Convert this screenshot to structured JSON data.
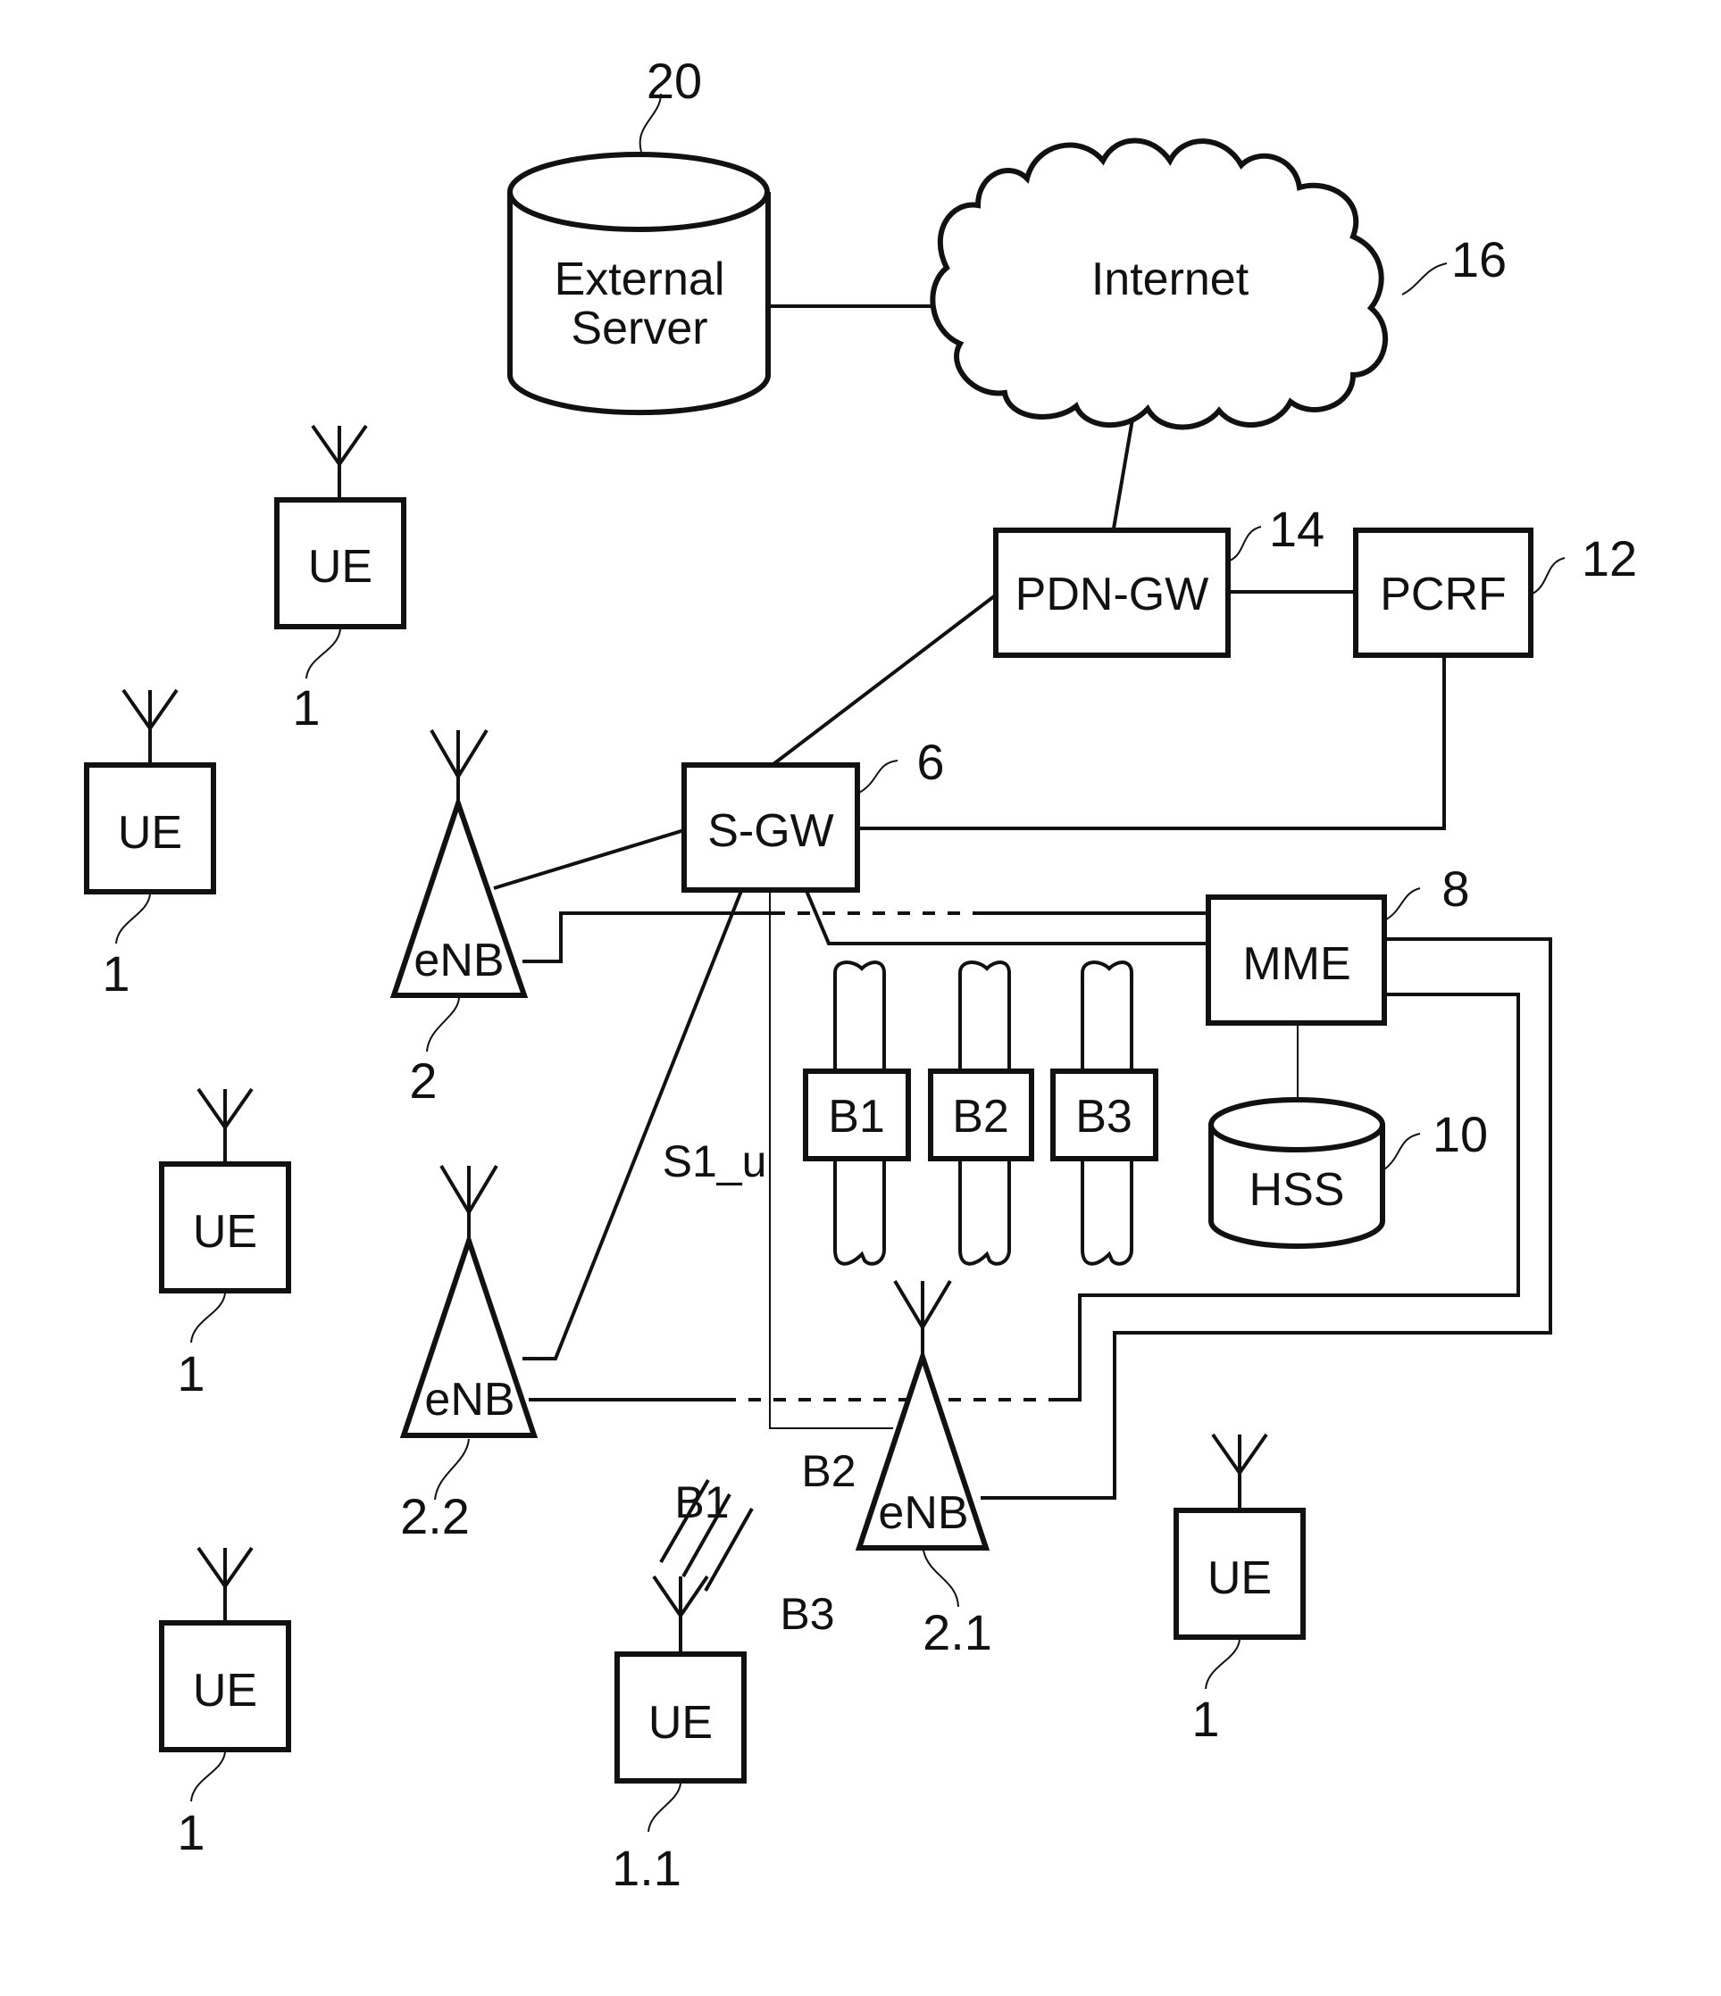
{
  "diagram": {
    "external_server": {
      "label_line1": "External",
      "label_line2": "Server",
      "ref": "20"
    },
    "internet": {
      "label": "Internet",
      "ref": "16"
    },
    "pdn_gw": {
      "label": "PDN-GW",
      "ref": "14"
    },
    "pcrf": {
      "label": "PCRF",
      "ref": "12"
    },
    "s_gw": {
      "label": "S-GW",
      "ref": "6"
    },
    "mme": {
      "label": "MME",
      "ref": "8"
    },
    "hss": {
      "label": "HSS",
      "ref": "10"
    },
    "bearers": [
      {
        "label": "B1"
      },
      {
        "label": "B2"
      },
      {
        "label": "B3"
      }
    ],
    "interface_label": "S1_u",
    "enbs": [
      {
        "label": "eNB",
        "ref": "2"
      },
      {
        "label": "eNB",
        "ref": "2.2"
      },
      {
        "label": "eNB",
        "ref": "2.1"
      }
    ],
    "ues": [
      {
        "label": "UE",
        "ref": "1"
      },
      {
        "label": "UE",
        "ref": "1"
      },
      {
        "label": "UE",
        "ref": "1"
      },
      {
        "label": "UE",
        "ref": "1"
      },
      {
        "label": "UE",
        "ref": "1.1"
      },
      {
        "label": "UE",
        "ref": "1"
      }
    ],
    "radio_bearers": [
      {
        "label": "B1"
      },
      {
        "label": "B2"
      },
      {
        "label": "B3"
      }
    ]
  }
}
